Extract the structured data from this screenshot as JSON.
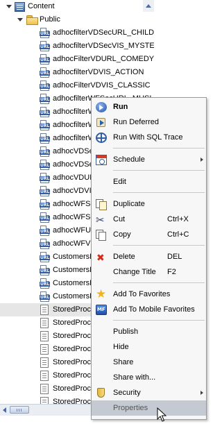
{
  "tree": {
    "root": {
      "label": "Content",
      "icon": "content-icon"
    },
    "folder": {
      "label": "Public",
      "icon": "folder-icon"
    },
    "items": [
      {
        "label": "adhocfilterVDSecURL_CHILD",
        "icon": "url-icon"
      },
      {
        "label": "adhocfilterVDSecVIS_MYSTE",
        "icon": "url-icon"
      },
      {
        "label": "adhocFilterVDURL_COMEDY",
        "icon": "url-icon"
      },
      {
        "label": "adhocfilterVDVIS_ACTION",
        "icon": "url-icon"
      },
      {
        "label": "adhocFilterVDVIS_CLASSIC",
        "icon": "url-icon"
      },
      {
        "label": "adhocfilterWFSecURL_MUSI",
        "icon": "url-icon"
      },
      {
        "label": "adhocfilterW",
        "icon": "url-icon"
      },
      {
        "label": "adhocfilterW",
        "icon": "url-icon"
      },
      {
        "label": "adhocfilterW",
        "icon": "url-icon"
      },
      {
        "label": "adhocVDSe",
        "icon": "url-icon"
      },
      {
        "label": "adhocVDSe",
        "icon": "url-icon"
      },
      {
        "label": "adhocVDUR",
        "icon": "url-icon"
      },
      {
        "label": "adhocVDVIS",
        "icon": "url-icon"
      },
      {
        "label": "adhocWFSe",
        "icon": "url-icon"
      },
      {
        "label": "adhocWFSe",
        "icon": "url-icon"
      },
      {
        "label": "adhocWFUR",
        "icon": "url-icon"
      },
      {
        "label": "adhocWFVI",
        "icon": "url-icon"
      },
      {
        "label": "CustomersD",
        "icon": "url-icon"
      },
      {
        "label": "CustomersD",
        "icon": "url-icon"
      },
      {
        "label": "CustomersD",
        "icon": "url-icon"
      },
      {
        "label": "CustomersD",
        "icon": "url-icon"
      },
      {
        "label": "StoredProc",
        "icon": "document-icon",
        "selected": true
      },
      {
        "label": "StoredProc",
        "icon": "document-icon"
      },
      {
        "label": "StoredProc",
        "icon": "document-icon"
      },
      {
        "label": "StoredProc",
        "icon": "document-icon"
      },
      {
        "label": "StoredProc",
        "icon": "document-icon"
      },
      {
        "label": "StoredProc",
        "icon": "document-icon"
      },
      {
        "label": "StoredProc",
        "icon": "document-icon"
      },
      {
        "label": "StoredProc",
        "icon": "document-icon"
      }
    ]
  },
  "context_menu": {
    "items": [
      {
        "label": "Run",
        "icon": "run-icon",
        "bold": true
      },
      {
        "label": "Run Deferred",
        "icon": "run-deferred-icon"
      },
      {
        "label": "Run With SQL Trace",
        "icon": "sql-trace-icon"
      },
      {
        "separator": true
      },
      {
        "label": "Schedule",
        "icon": "schedule-icon",
        "submenu": true
      },
      {
        "separator": true
      },
      {
        "label": "Edit"
      },
      {
        "separator": true
      },
      {
        "label": "Duplicate",
        "icon": "duplicate-icon"
      },
      {
        "label": "Cut",
        "icon": "cut-icon",
        "shortcut": "Ctrl+X"
      },
      {
        "label": "Copy",
        "icon": "copy-icon",
        "shortcut": "Ctrl+C"
      },
      {
        "separator": true
      },
      {
        "label": "Delete",
        "icon": "delete-icon",
        "shortcut": "DEL"
      },
      {
        "label": "Change Title",
        "shortcut": "F2"
      },
      {
        "separator": true
      },
      {
        "label": "Add To Favorites",
        "icon": "favorites-star-icon"
      },
      {
        "label": "Add To Mobile Favorites",
        "icon": "mobile-favorites-icon",
        "icon_text": "MF"
      },
      {
        "separator": true
      },
      {
        "label": "Publish"
      },
      {
        "label": "Hide"
      },
      {
        "label": "Share"
      },
      {
        "label": "Share with..."
      },
      {
        "label": "Security",
        "icon": "security-shield-icon",
        "submenu": true
      },
      {
        "label": "Properties",
        "highlighted": true
      }
    ]
  },
  "colors": {
    "menu_background": "#f7f7f7",
    "menu_highlight": "#c5cad2",
    "selected_row": "#e6e6e6",
    "url_badge": "#2f5da8",
    "delete_red": "#d42a1a"
  }
}
